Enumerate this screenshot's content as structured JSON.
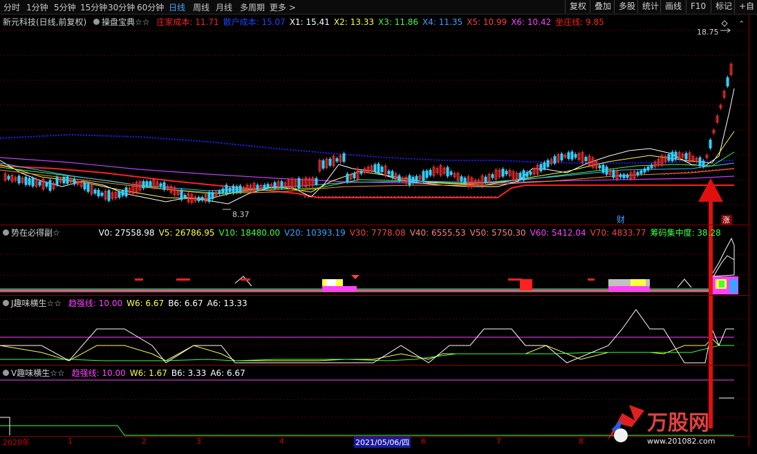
{
  "toolbar": {
    "timeframes": [
      "分时",
      "1分钟",
      "5分钟",
      "15分钟",
      "30分钟",
      "60分钟",
      "日线",
      "周线",
      "月线",
      "多周期",
      "更多 >"
    ],
    "active_index": 6,
    "right_buttons": [
      "复权",
      "叠加",
      "多股",
      "统计",
      "画线",
      "F10",
      "标记",
      "+自"
    ]
  },
  "main": {
    "title": "新元科技(日线,前复权)",
    "indicator": "操盘宝典☆☆",
    "values": [
      {
        "label": "庄家成本: 11.71",
        "color": "#ff2020"
      },
      {
        "label": "散户成本: 15.07",
        "color": "#2040ff"
      },
      {
        "label": "X1: 15.41",
        "color": "#ffffff"
      },
      {
        "label": "X2: 13.33",
        "color": "#ffff40"
      },
      {
        "label": "X3: 11.86",
        "color": "#40ff40"
      },
      {
        "label": "X4: 11.35",
        "color": "#40a0ff"
      },
      {
        "label": "X5: 10.99",
        "color": "#ff4040"
      },
      {
        "label": "X6: 10.42",
        "color": "#ff40ff"
      },
      {
        "label": "坐庄线: 9.85",
        "color": "#ff2020"
      }
    ],
    "high_label": "18.75",
    "low_label": "8.37",
    "cai_label": "财",
    "zhang_label": "涨"
  },
  "panel2": {
    "title": "势在必得副☆",
    "values": [
      {
        "label": "V0: 27558.98",
        "color": "#ffffff"
      },
      {
        "label": "V5: 26786.95",
        "color": "#ffff40"
      },
      {
        "label": "V10: 18480.00",
        "color": "#40ff40"
      },
      {
        "label": "V20: 10393.19",
        "color": "#40a0ff"
      },
      {
        "label": "V30: 7778.08",
        "color": "#ff4040"
      },
      {
        "label": "V40: 6555.53",
        "color": "#ff8080"
      },
      {
        "label": "V50: 5750.30",
        "color": "#ff8080"
      },
      {
        "label": "V60: 5412.04",
        "color": "#ff40ff"
      },
      {
        "label": "V70: 4833.77",
        "color": "#ff4040"
      },
      {
        "label": "筹码集中度: 38.28",
        "color": "#40ff40"
      }
    ]
  },
  "panel3": {
    "title": "J趣味横生☆☆",
    "values": [
      {
        "label": "趋强线: 10.00",
        "color": "#ff40ff"
      },
      {
        "label": "W6: 6.67",
        "color": "#ffff40"
      },
      {
        "label": "B6: 6.67",
        "color": "#ffffff"
      },
      {
        "label": "A6: 13.33",
        "color": "#ffffff"
      }
    ]
  },
  "panel4": {
    "title": "V趣味横生☆☆",
    "values": [
      {
        "label": "趋强线: 10.00",
        "color": "#ff40ff"
      },
      {
        "label": "W6: 1.67",
        "color": "#ffff40"
      },
      {
        "label": "B6: 3.33",
        "color": "#ffffff"
      },
      {
        "label": "A6: 6.67",
        "color": "#ffffff"
      }
    ]
  },
  "date_axis": {
    "labels": [
      "2020年",
      "1",
      "2",
      "3",
      "4",
      "2021/05/06/四",
      "6",
      "7",
      "8"
    ],
    "highlight_index": 5
  },
  "watermark": {
    "brand": "万股网",
    "url": "www.201082.com"
  }
}
